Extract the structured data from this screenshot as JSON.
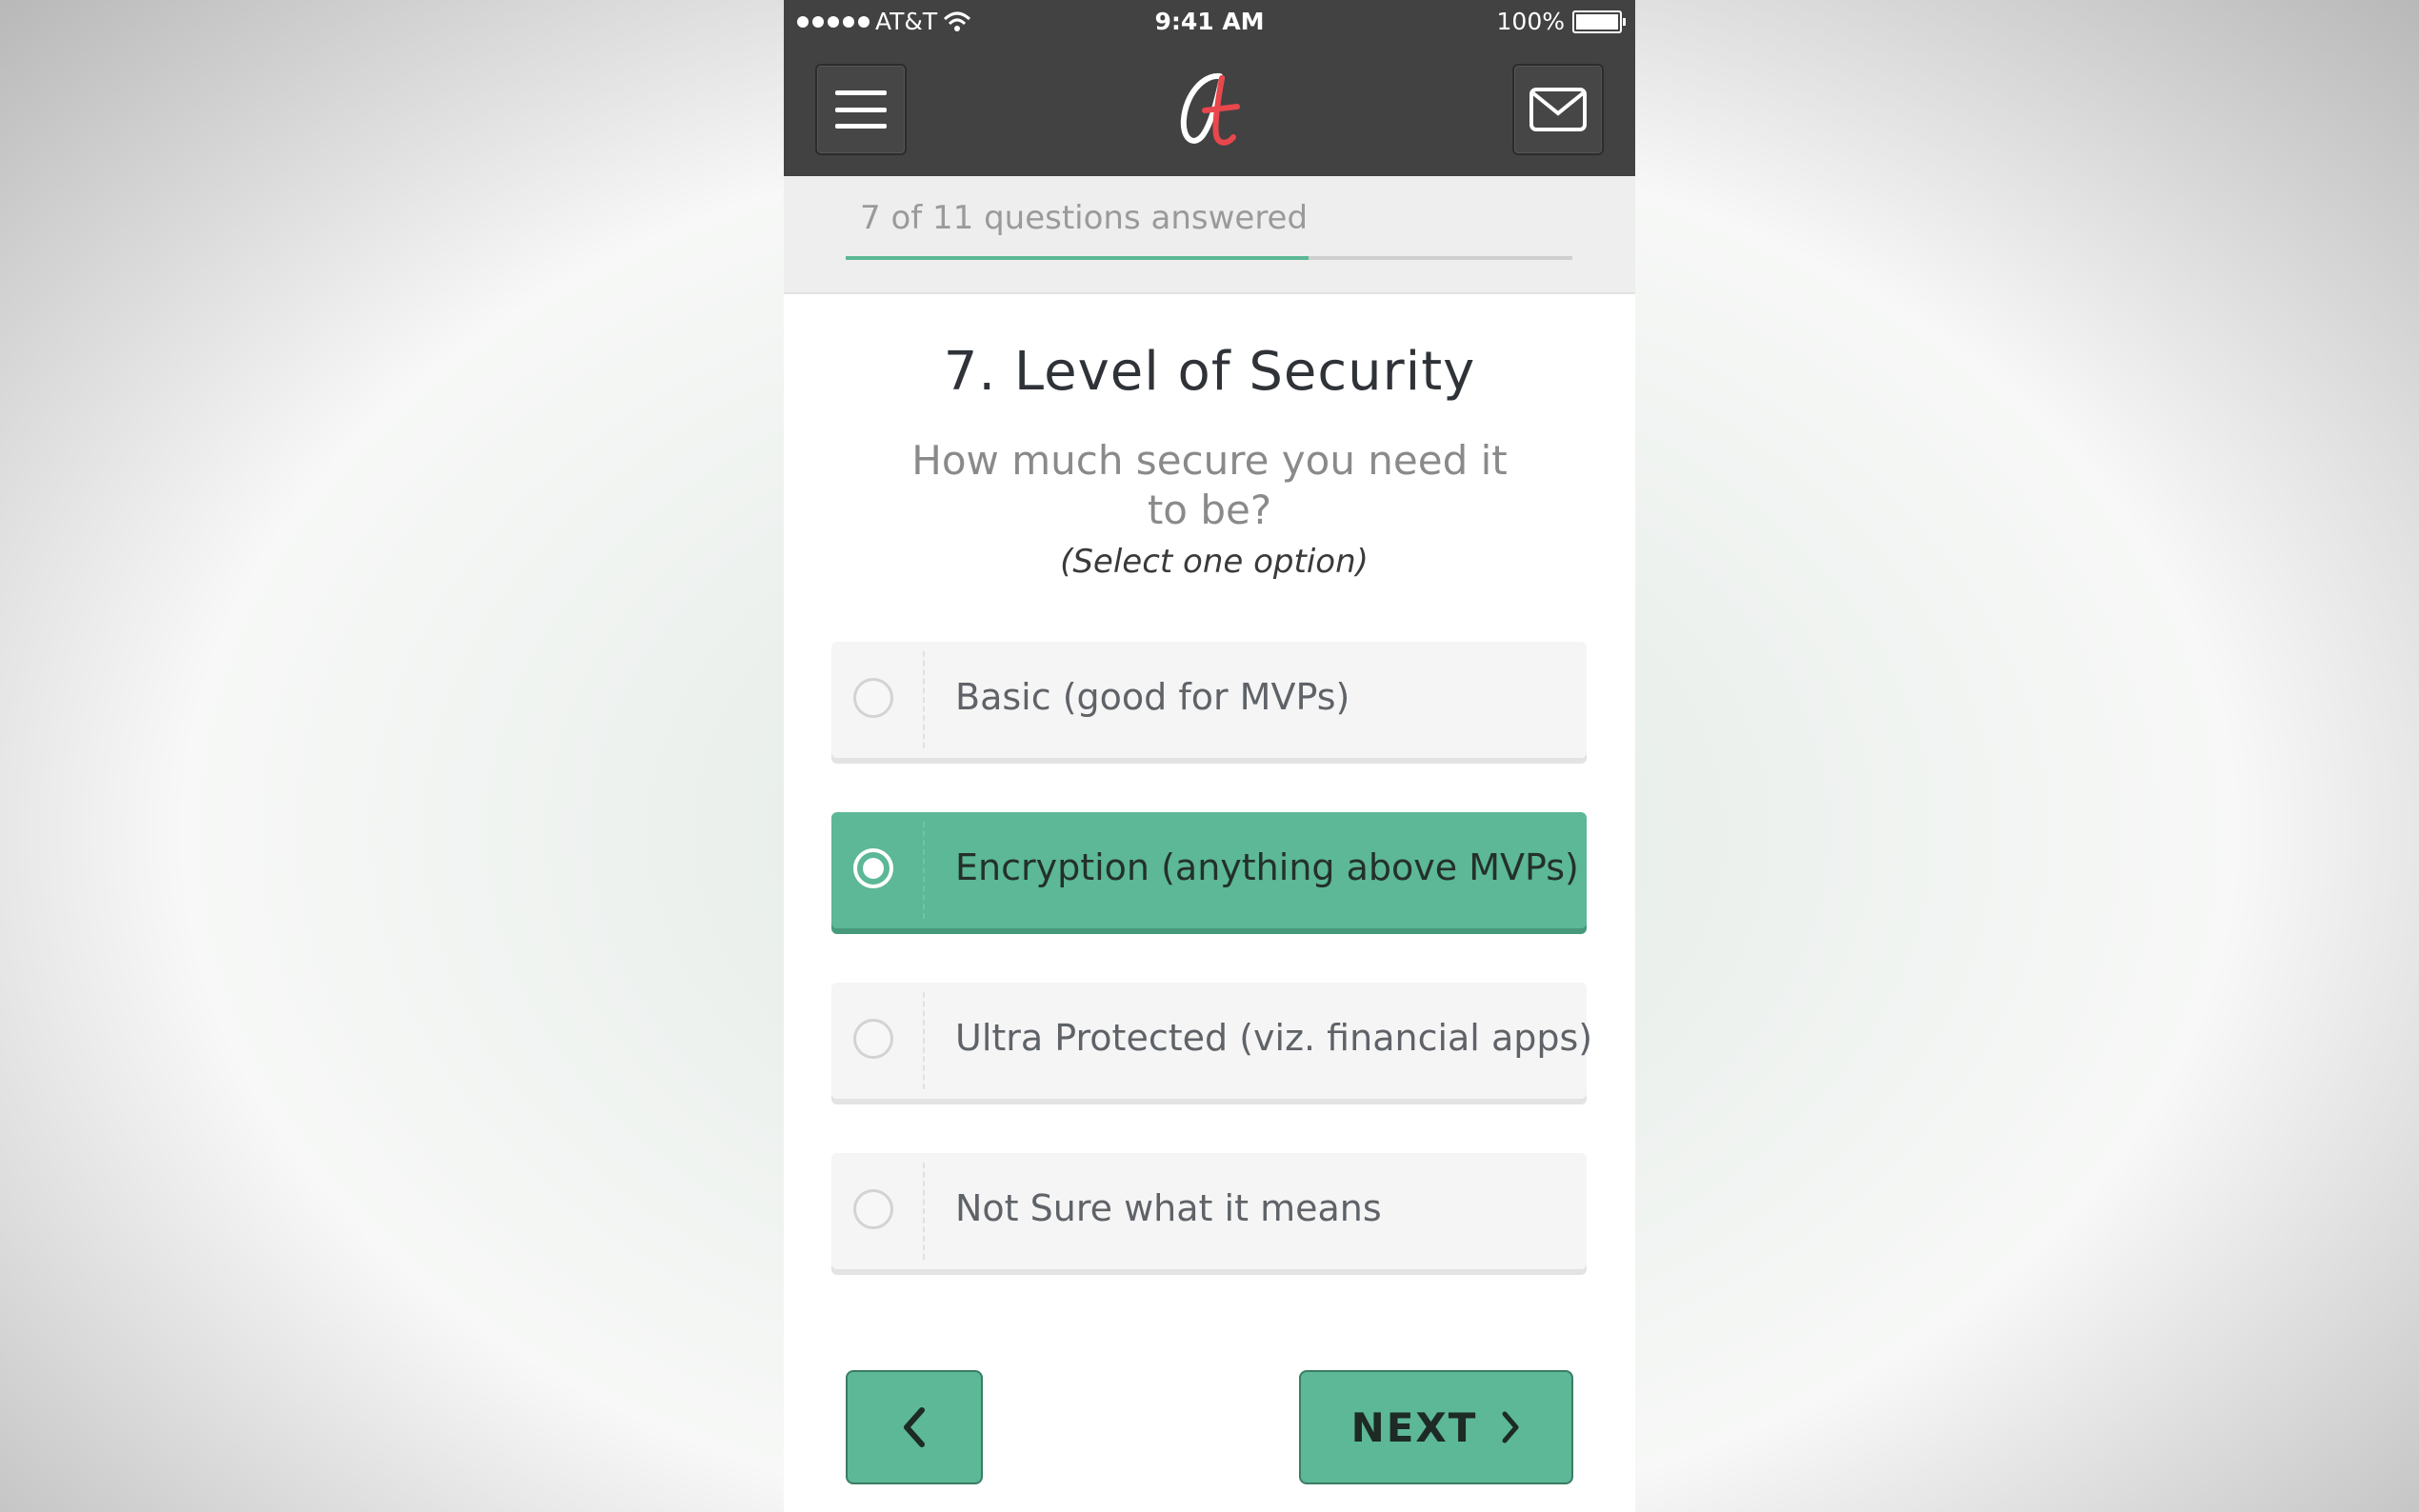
{
  "status_bar": {
    "carrier": "AT&T",
    "time": "9:41 AM",
    "battery": "100%"
  },
  "header": {
    "menu_icon": "hamburger-menu-icon",
    "logo_icon": "brand-logo-icon",
    "mail_icon": "mail-envelope-icon"
  },
  "progress": {
    "text": "7 of 11 questions answered",
    "answered": 7,
    "total": 11,
    "fill_color": "#5cb896"
  },
  "question": {
    "title": "7. Level of Security",
    "text": "How much secure you need it to be?",
    "hint": "(Select one option)"
  },
  "options": [
    {
      "label_main": "Basic",
      "label_sub": " (good for MVPs)",
      "selected": false
    },
    {
      "label_main": "Encryption",
      "label_sub": " (anything above MVPs)",
      "selected": true
    },
    {
      "label_main": "Ultra Protected",
      "label_sub": " (viz. financial apps)",
      "selected": false
    },
    {
      "label_main": "Not Sure what it means",
      "label_sub": "",
      "selected": false
    }
  ],
  "nav": {
    "back_icon": "chevron-left-icon",
    "next_label": "NEXT",
    "next_icon": "chevron-right-icon"
  },
  "colors": {
    "accent": "#5cb896",
    "header_bg": "#424242",
    "logo_red": "#e8474c"
  }
}
